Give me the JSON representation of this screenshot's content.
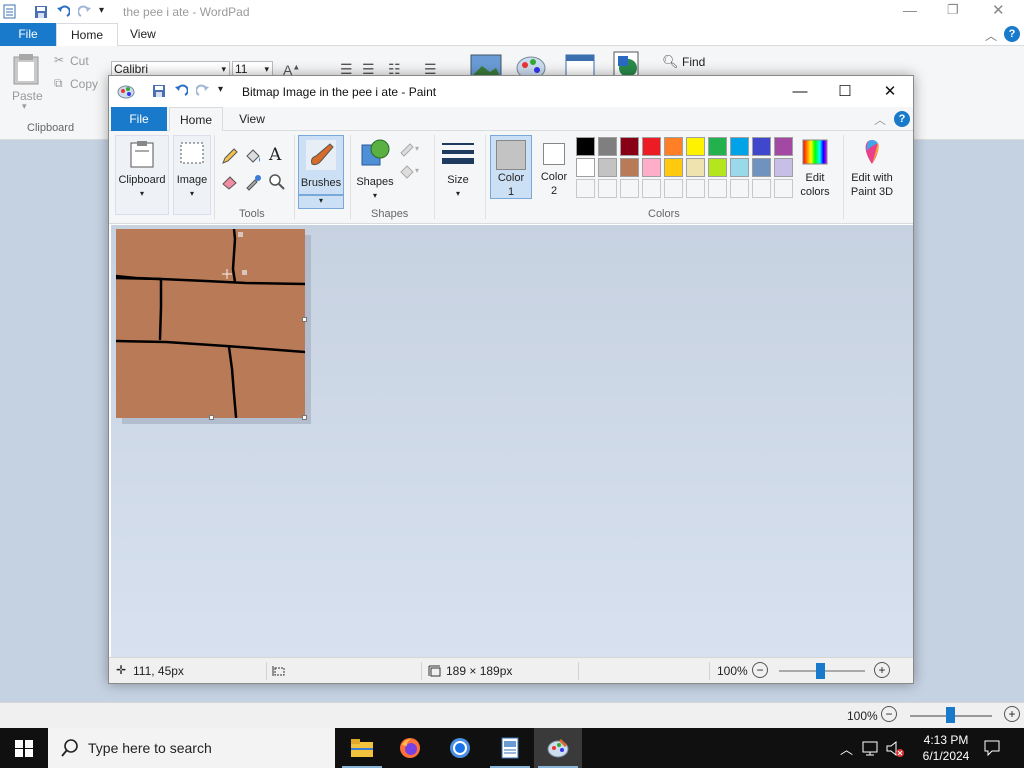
{
  "wordpad": {
    "title": "the pee i ate - WordPad",
    "tabs": [
      "File",
      "Home",
      "View"
    ],
    "font_name": "Calibri",
    "font_size": "11",
    "cut_label": "Cut",
    "copy_label": "Copy",
    "paste_label": "Paste",
    "clipboard_label": "Clipboard",
    "find_label": "Find",
    "zoom": "100%"
  },
  "paint": {
    "title": "Bitmap Image in the pee i ate - Paint",
    "tabs": {
      "file": "File",
      "home": "Home",
      "view": "View"
    },
    "ribbon": {
      "clipboard": "Clipboard",
      "image": "Image",
      "tools_label": "Tools",
      "brushes": "Brushes",
      "shapes": "Shapes",
      "shapes_group": "Shapes",
      "size": "Size",
      "color1": "Color\n1",
      "color1_a": "Color",
      "color1_b": "1",
      "color2_a": "Color",
      "color2_b": "2",
      "colors_group": "Colors",
      "edit_colors_a": "Edit",
      "edit_colors_b": "colors",
      "paint3d_a": "Edit with",
      "paint3d_b": "Paint 3D"
    },
    "palette_row1": [
      "#000000",
      "#7f7f7f",
      "#880015",
      "#ed1c24",
      "#ff7f27",
      "#fff200",
      "#22b14c",
      "#00a2e8",
      "#3f48cc",
      "#a349a4"
    ],
    "palette_row2": [
      "#ffffff",
      "#c3c3c3",
      "#b97a57",
      "#ffaec9",
      "#ffc90e",
      "#efe4b0",
      "#b5e61d",
      "#99d9ea",
      "#7092be",
      "#c8bfe7"
    ],
    "color1_value": "#c3c3c3",
    "color2_value": "#ffffff",
    "canvas_color": "#b97b57",
    "status": {
      "cursor_pos": "111, 45px",
      "image_size": "189 × 189px",
      "zoom": "100%"
    }
  },
  "taskbar": {
    "search_placeholder": "Type here to search",
    "time": "4:13 PM",
    "date": "6/1/2024"
  }
}
